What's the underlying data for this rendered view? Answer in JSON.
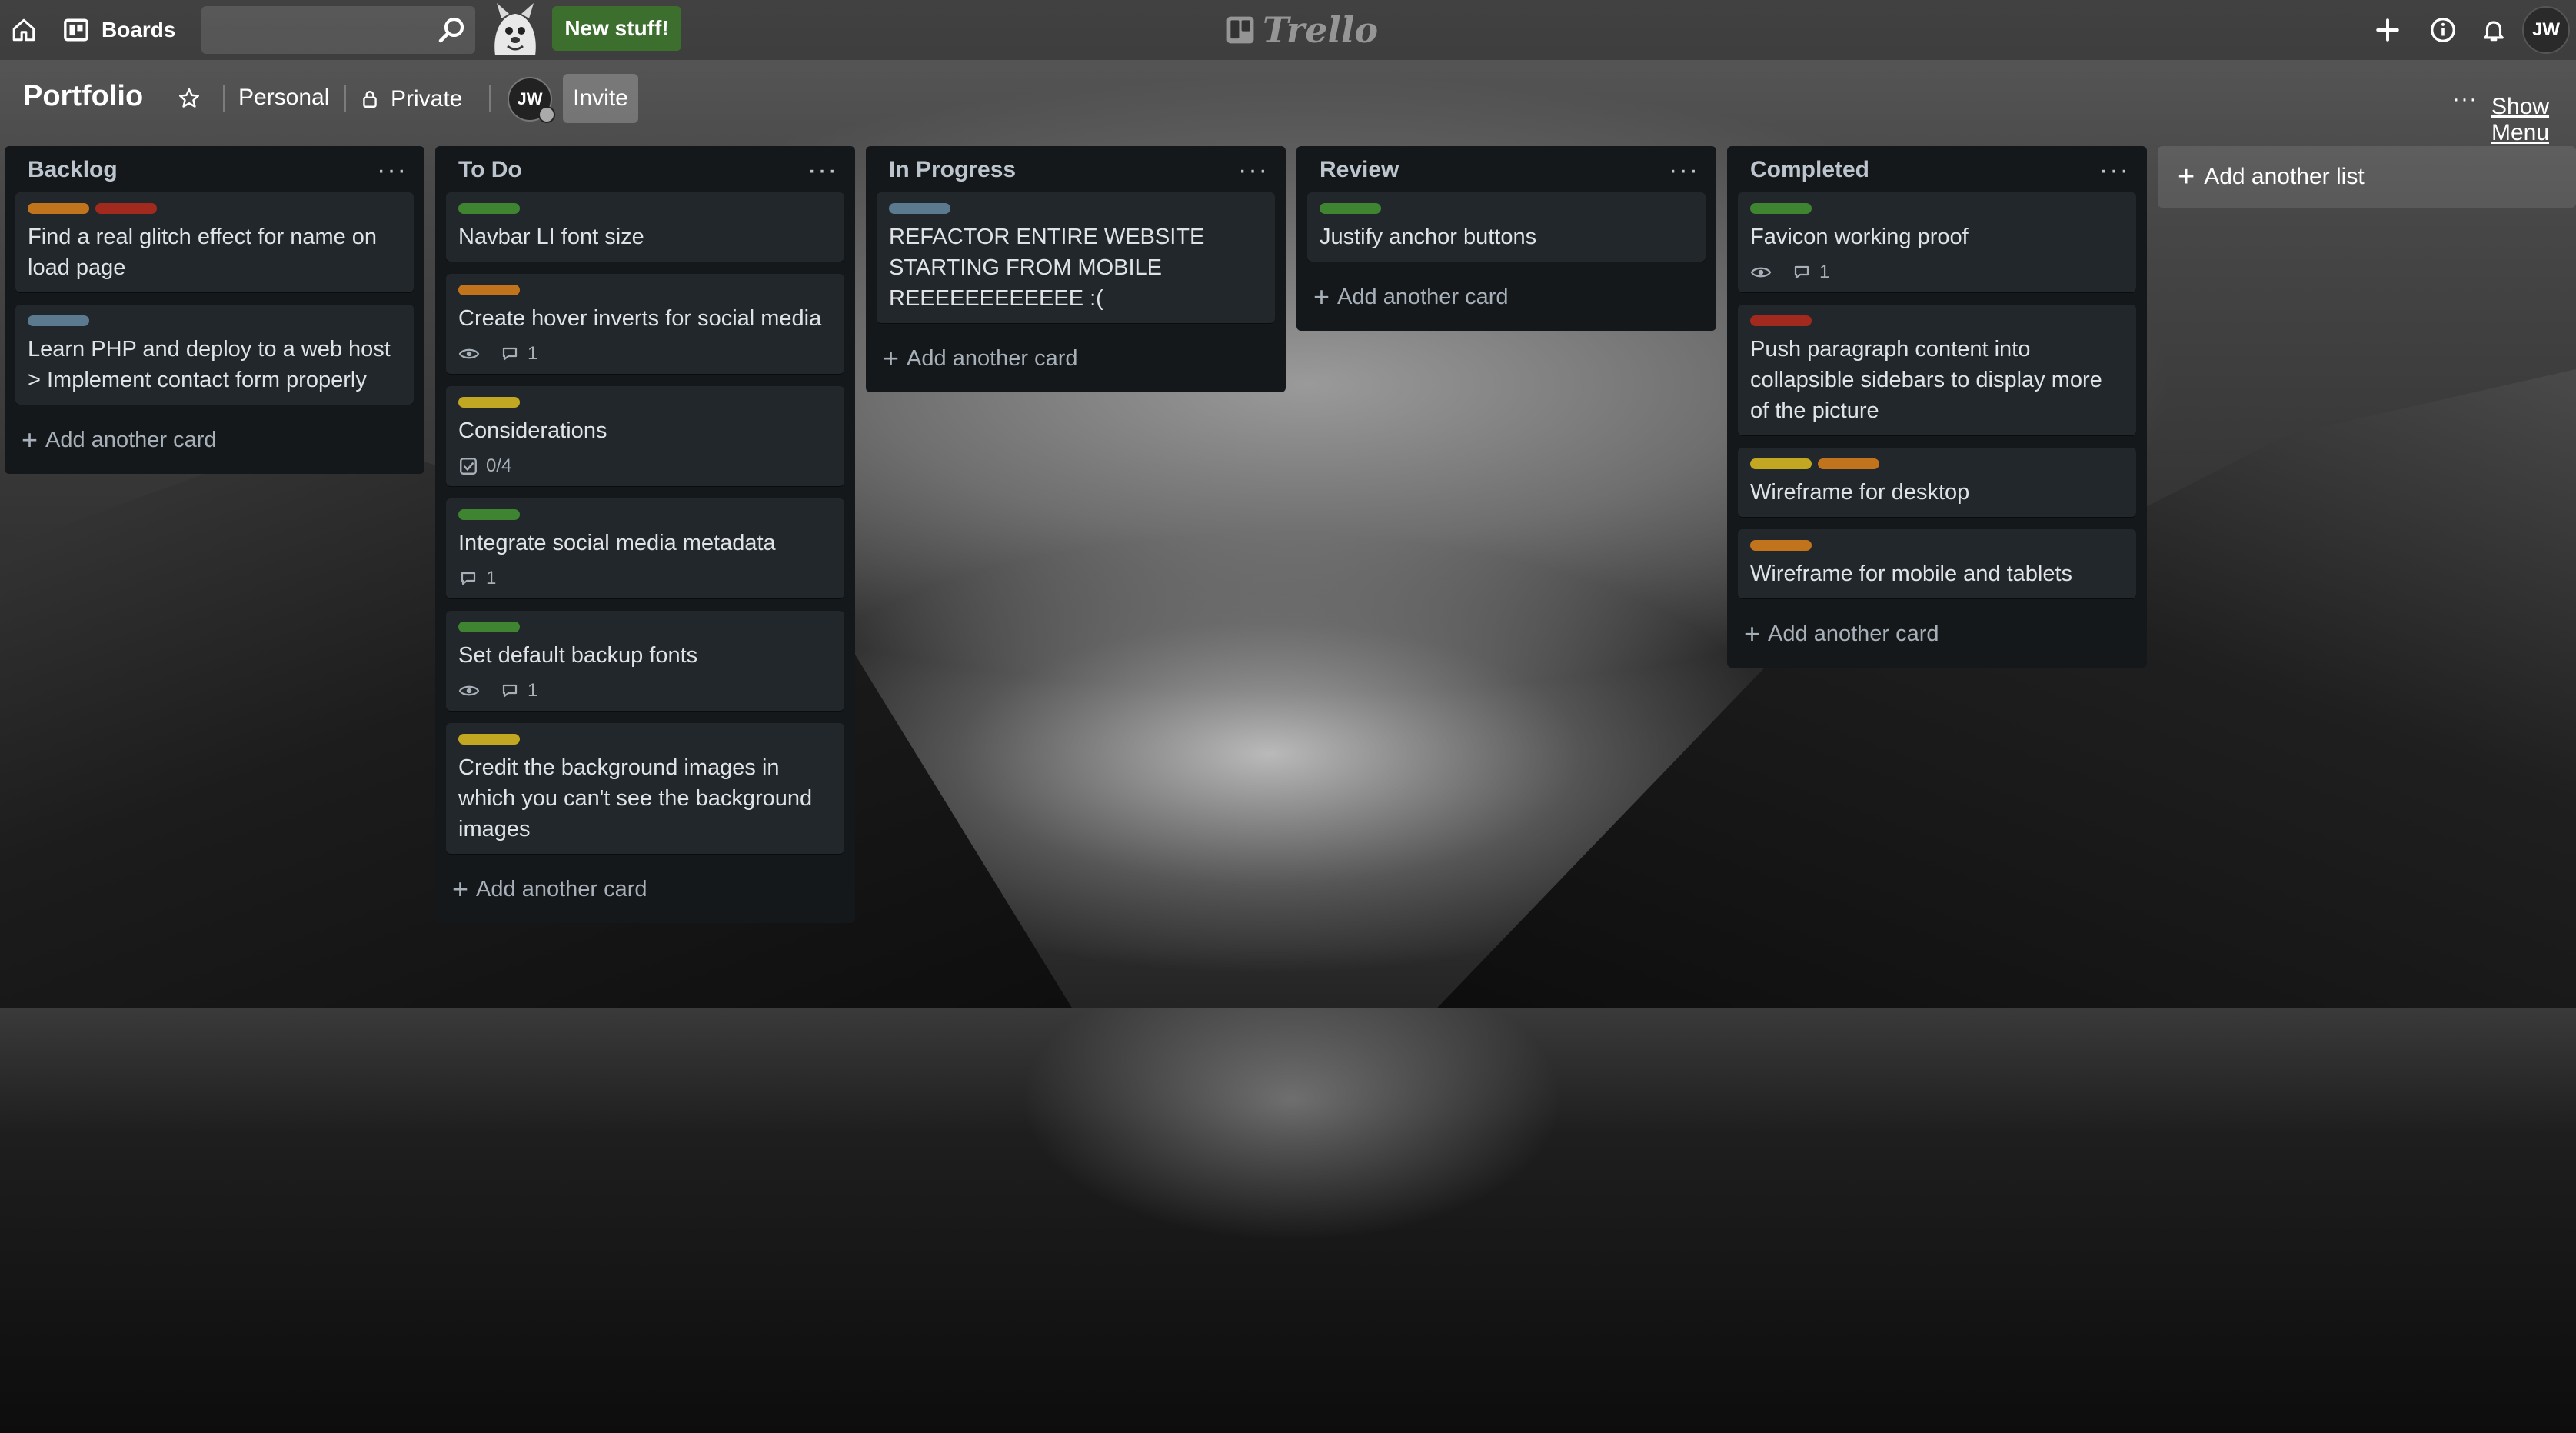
{
  "topbar": {
    "boards_label": "Boards",
    "new_stuff_label": "New stuff!",
    "logo_text": "Trello",
    "user_initials": "JW"
  },
  "board": {
    "title": "Portfolio",
    "visibility_team": "Personal",
    "privacy": "Private",
    "member_initials": "JW",
    "invite_label": "Invite",
    "show_menu_label": "Show Menu"
  },
  "label_colors": {
    "orange": "#c2741d",
    "red": "#a2291d",
    "green": "#3f8430",
    "yellow": "#c1a722",
    "blue": "#5b7a90"
  },
  "lists": [
    {
      "title": "Backlog",
      "add_card_label": "Add another card",
      "cards": [
        {
          "labels": [
            "orange",
            "red"
          ],
          "title": "Find a real glitch effect for name on load page"
        },
        {
          "labels": [
            "blue"
          ],
          "title": "Learn PHP and deploy to a web host > Implement contact form properly"
        }
      ]
    },
    {
      "title": "To Do",
      "add_card_label": "Add another card",
      "cards": [
        {
          "labels": [
            "green"
          ],
          "title": "Navbar LI font size"
        },
        {
          "labels": [
            "orange"
          ],
          "title": "Create hover inverts for social media",
          "watch": true,
          "comments": "1"
        },
        {
          "labels": [
            "yellow"
          ],
          "title": "Considerations",
          "checklist": "0/4"
        },
        {
          "labels": [
            "green"
          ],
          "title": "Integrate social media metadata",
          "comments": "1"
        },
        {
          "labels": [
            "green"
          ],
          "title": "Set default backup fonts",
          "watch": true,
          "comments": "1"
        },
        {
          "labels": [
            "yellow"
          ],
          "title": "Credit the background images in which you can't see the background images"
        }
      ]
    },
    {
      "title": "In Progress",
      "add_card_label": "Add another card",
      "cards": [
        {
          "labels": [
            "blue"
          ],
          "title": "REFACTOR ENTIRE WEBSITE STARTING FROM MOBILE REEEEEEEEEEEE :("
        }
      ]
    },
    {
      "title": "Review",
      "add_card_label": "Add another card",
      "cards": [
        {
          "labels": [
            "green"
          ],
          "title": "Justify anchor buttons"
        }
      ]
    },
    {
      "title": "Completed",
      "add_card_label": "Add another card",
      "cards": [
        {
          "labels": [
            "green"
          ],
          "title": "Favicon working proof",
          "watch": true,
          "comments": "1"
        },
        {
          "labels": [
            "red"
          ],
          "title": "Push paragraph content into collapsible sidebars to display more of the picture"
        },
        {
          "labels": [
            "yellow",
            "orange"
          ],
          "title": "Wireframe for desktop"
        },
        {
          "labels": [
            "orange"
          ],
          "title": "Wireframe for mobile and tablets"
        }
      ]
    }
  ],
  "add_list_label": "Add another list"
}
